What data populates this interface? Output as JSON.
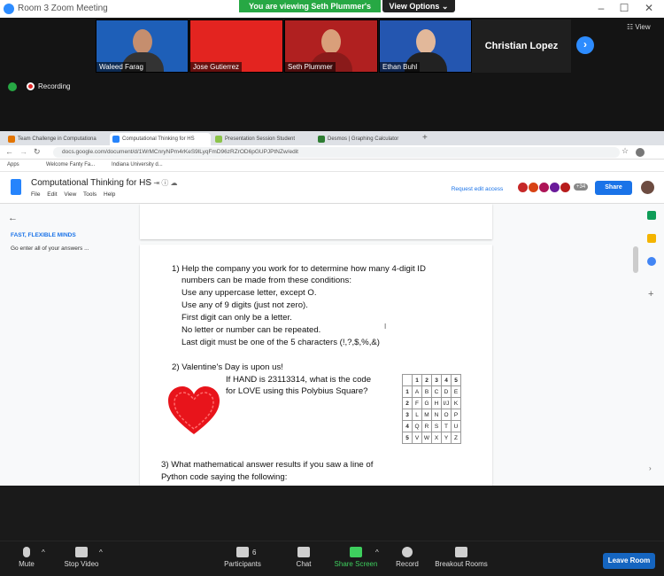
{
  "window": {
    "title": "Room 3   Zoom Meeting",
    "minimize": "–",
    "maximize": "☐",
    "close": "✕"
  },
  "banner": {
    "viewing": "You are viewing Seth Plummer's screen",
    "view_options": "View Options ⌄"
  },
  "view_button": "☷ View",
  "participants": [
    {
      "name": "Waleed Farag",
      "bg": "#1e5fb8"
    },
    {
      "name": "Jose Gutierrez",
      "bg": "#e32420"
    },
    {
      "name": "Seth Plummer",
      "bg": "#b02020"
    },
    {
      "name": "Ethan Buhl",
      "bg": "#2456b0"
    }
  ],
  "christian": "Christian Lopez",
  "recording": "Recording",
  "browser": {
    "tabs": [
      "Team Challenge in Computationa",
      "Computational Thinking for HS",
      "Presentation Session Student",
      "Desmos | Graphing Calculator"
    ],
    "new_tab": "+",
    "url": "docs.google.com/document/d/1WrMCnryNPm4rKeS9lLyqFmD96zRZrOD6pGUPJPtNZw/edit",
    "bookmarks": [
      "Apps",
      "Welcome Fanty Fa...",
      "Indiana University d..."
    ]
  },
  "docs": {
    "title": "Computational Thinking for HS",
    "menu": [
      "File",
      "Edit",
      "View",
      "Tools",
      "Help"
    ],
    "request_edit": "Request edit access",
    "share": "Share",
    "avatar_count": "+34",
    "outline_heading": "FAST, FLEXIBLE MINDS",
    "outline_item": "Go enter all of your answers ..."
  },
  "doc": {
    "q1": "1) Help the company you work for to determine how many 4-digit ID",
    "q1b": "numbers can be made from these conditions:",
    "c1": "Use any uppercase letter, except O.",
    "c2": "Use any of 9 digits (just not zero).",
    "c3": "First digit can only be a letter.",
    "c4": "No letter or number can be repeated.",
    "c5": "Last digit must be one of the 5 characters (!,?,$,%,&)",
    "q2": "2) Valentine's Day is upon us!",
    "q2b": "If HAND is 23113314, what is the code",
    "q2c": "for LOVE using this Polybius Square?",
    "q3": "3) What mathematical answer results if you saw a line of",
    "q3b": "Python code saying the following:",
    "square": [
      [
        "",
        "1",
        "2",
        "3",
        "4",
        "5"
      ],
      [
        "1",
        "A",
        "B",
        "C",
        "D",
        "E"
      ],
      [
        "2",
        "F",
        "G",
        "H",
        "I/J",
        "K"
      ],
      [
        "3",
        "L",
        "M",
        "N",
        "O",
        "P"
      ],
      [
        "4",
        "Q",
        "R",
        "S",
        "T",
        "U"
      ],
      [
        "5",
        "V",
        "W",
        "X",
        "Y",
        "Z"
      ]
    ]
  },
  "toolbar": {
    "mute": "Mute",
    "stop_video": "Stop Video",
    "participants": "Participants",
    "participants_count": "6",
    "chat": "Chat",
    "share_screen": "Share Screen",
    "record": "Record",
    "breakout": "Breakout Rooms",
    "leave": "Leave Room"
  }
}
